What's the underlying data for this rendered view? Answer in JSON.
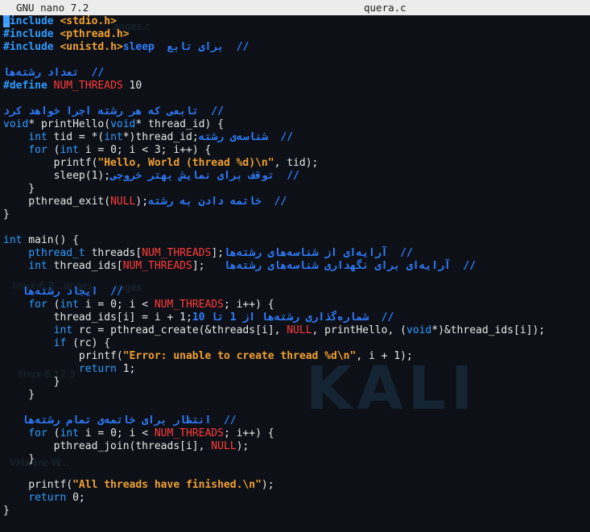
{
  "titlebar": {
    "app": "GNU nano 7.2",
    "file": "quera.c"
  },
  "code": [
    [
      [
        "pp",
        "#"
      ],
      [
        "pp",
        "include "
      ],
      [
        "inc",
        "<stdio.h>"
      ]
    ],
    [
      [
        "pp",
        "#include "
      ],
      [
        "inc",
        "<pthread.h>"
      ]
    ],
    [
      [
        "pp",
        "#include "
      ],
      [
        "inc",
        "<unistd.h>"
      ],
      [
        "cm",
        "//  برای تابع  sleep"
      ]
    ],
    [
      [
        "txt",
        ""
      ]
    ],
    [
      [
        "cm",
        "//  تعداد رشته‌ها"
      ]
    ],
    [
      [
        "pp",
        "#define "
      ],
      [
        "mac",
        "NUM_THREADS"
      ],
      [
        "op",
        " 10"
      ]
    ],
    [
      [
        "txt",
        ""
      ]
    ],
    [
      [
        "cm",
        "//  تابعی که هر رشته اجرا خواهد کرد"
      ]
    ],
    [
      [
        "type",
        "void"
      ],
      [
        "op",
        "* printHello("
      ],
      [
        "type",
        "void"
      ],
      [
        "op",
        "* thread_id) {"
      ]
    ],
    [
      [
        "op",
        "    "
      ],
      [
        "type",
        "int"
      ],
      [
        "op",
        " tid = *("
      ],
      [
        "type",
        "int"
      ],
      [
        "op",
        "*)thread_id;"
      ],
      [
        "cm",
        "//  شناسه‌ی رشته"
      ]
    ],
    [
      [
        "op",
        "    "
      ],
      [
        "kw",
        "for"
      ],
      [
        "op",
        " ("
      ],
      [
        "type",
        "int"
      ],
      [
        "op",
        " i = 0; i < 3; i++) {"
      ]
    ],
    [
      [
        "op",
        "        printf("
      ],
      [
        "str",
        "\"Hello, World (thread %d)\\n\""
      ],
      [
        "op",
        ", tid);"
      ]
    ],
    [
      [
        "op",
        "        sleep(1);"
      ],
      [
        "cm",
        "//  توقف برای نمایش بهتر خروجی"
      ]
    ],
    [
      [
        "op",
        "    }"
      ]
    ],
    [
      [
        "op",
        "    pthread_exit("
      ],
      [
        "nul",
        "NULL"
      ],
      [
        "op",
        ");"
      ],
      [
        "cm",
        "//  خاتمه دادن به رشته"
      ]
    ],
    [
      [
        "op",
        "}"
      ]
    ],
    [
      [
        "txt",
        ""
      ]
    ],
    [
      [
        "type",
        "int"
      ],
      [
        "op",
        " main() {"
      ]
    ],
    [
      [
        "op",
        "    "
      ],
      [
        "type",
        "pthread_t"
      ],
      [
        "op",
        " threads["
      ],
      [
        "mac",
        "NUM_THREADS"
      ],
      [
        "op",
        "];"
      ],
      [
        "cm",
        "//  آرایه‌ای از شناسه‌های رشته‌ها"
      ]
    ],
    [
      [
        "op",
        "    "
      ],
      [
        "type",
        "int"
      ],
      [
        "op",
        " thread_ids["
      ],
      [
        "mac",
        "NUM_THREADS"
      ],
      [
        "op",
        "];   "
      ],
      [
        "cm",
        "//  آرایه‌ای برای نگهداری شناسه‌های رشته‌ها"
      ]
    ],
    [
      [
        "txt",
        ""
      ]
    ],
    [
      [
        "op",
        "   "
      ],
      [
        "cm",
        "//  ایجاد رشته‌ها"
      ]
    ],
    [
      [
        "op",
        "    "
      ],
      [
        "kw",
        "for"
      ],
      [
        "op",
        " ("
      ],
      [
        "type",
        "int"
      ],
      [
        "op",
        " i = 0; i < "
      ],
      [
        "mac",
        "NUM_THREADS"
      ],
      [
        "op",
        "; i++) {"
      ]
    ],
    [
      [
        "op",
        "        thread_ids[i] = i + 1;"
      ],
      [
        "cm",
        "//  شماره‌گذاری رشته‌ها از 1 تا 10"
      ]
    ],
    [
      [
        "op",
        "        "
      ],
      [
        "type",
        "int"
      ],
      [
        "op",
        " rc = pthread_create(&threads[i], "
      ],
      [
        "nul",
        "NULL"
      ],
      [
        "op",
        ", printHello, ("
      ],
      [
        "type",
        "void"
      ],
      [
        "op",
        "*)&thread_ids[i]);"
      ]
    ],
    [
      [
        "op",
        "        "
      ],
      [
        "kw",
        "if"
      ],
      [
        "op",
        " (rc) {"
      ]
    ],
    [
      [
        "op",
        "            printf("
      ],
      [
        "str",
        "\"Error: unable to create thread %d\\n\""
      ],
      [
        "op",
        ", i + 1);"
      ]
    ],
    [
      [
        "op",
        "            "
      ],
      [
        "kw",
        "return"
      ],
      [
        "op",
        " 1;"
      ]
    ],
    [
      [
        "op",
        "        }"
      ]
    ],
    [
      [
        "op",
        "    }"
      ]
    ],
    [
      [
        "txt",
        ""
      ]
    ],
    [
      [
        "op",
        "   "
      ],
      [
        "cm",
        "//  انتظار برای خاتمه‌ی تمام رشته‌ها"
      ]
    ],
    [
      [
        "op",
        "    "
      ],
      [
        "kw",
        "for"
      ],
      [
        "op",
        " ("
      ],
      [
        "type",
        "int"
      ],
      [
        "op",
        " i = 0; i < "
      ],
      [
        "mac",
        "NUM_THREADS"
      ],
      [
        "op",
        "; i++) {"
      ]
    ],
    [
      [
        "op",
        "        pthread_join(threads[i], "
      ],
      [
        "nul",
        "NULL"
      ],
      [
        "op",
        ");"
      ]
    ],
    [
      [
        "op",
        "    }"
      ]
    ],
    [
      [
        "txt",
        ""
      ]
    ],
    [
      [
        "op",
        "    printf("
      ],
      [
        "str",
        "\"All threads have finished.\\n\""
      ],
      [
        "op",
        ");"
      ]
    ],
    [
      [
        "op",
        "    "
      ],
      [
        "kw",
        "return"
      ],
      [
        "op",
        " 0;"
      ]
    ],
    [
      [
        "op",
        "}"
      ]
    ]
  ],
  "watermark": {
    "brand": "KALI",
    "files": [
      "linux-6.8...anges",
      "linux-6.12.3",
      "VMware-W...",
      "anges.c",
      "anges"
    ]
  },
  "colors": {
    "background": "#0d1117",
    "keyword": "#2f9bff",
    "string": "#f0a030",
    "macro": "#ff3b3b",
    "comment": "#2f7dff",
    "cursor": "#4aa3ff"
  }
}
